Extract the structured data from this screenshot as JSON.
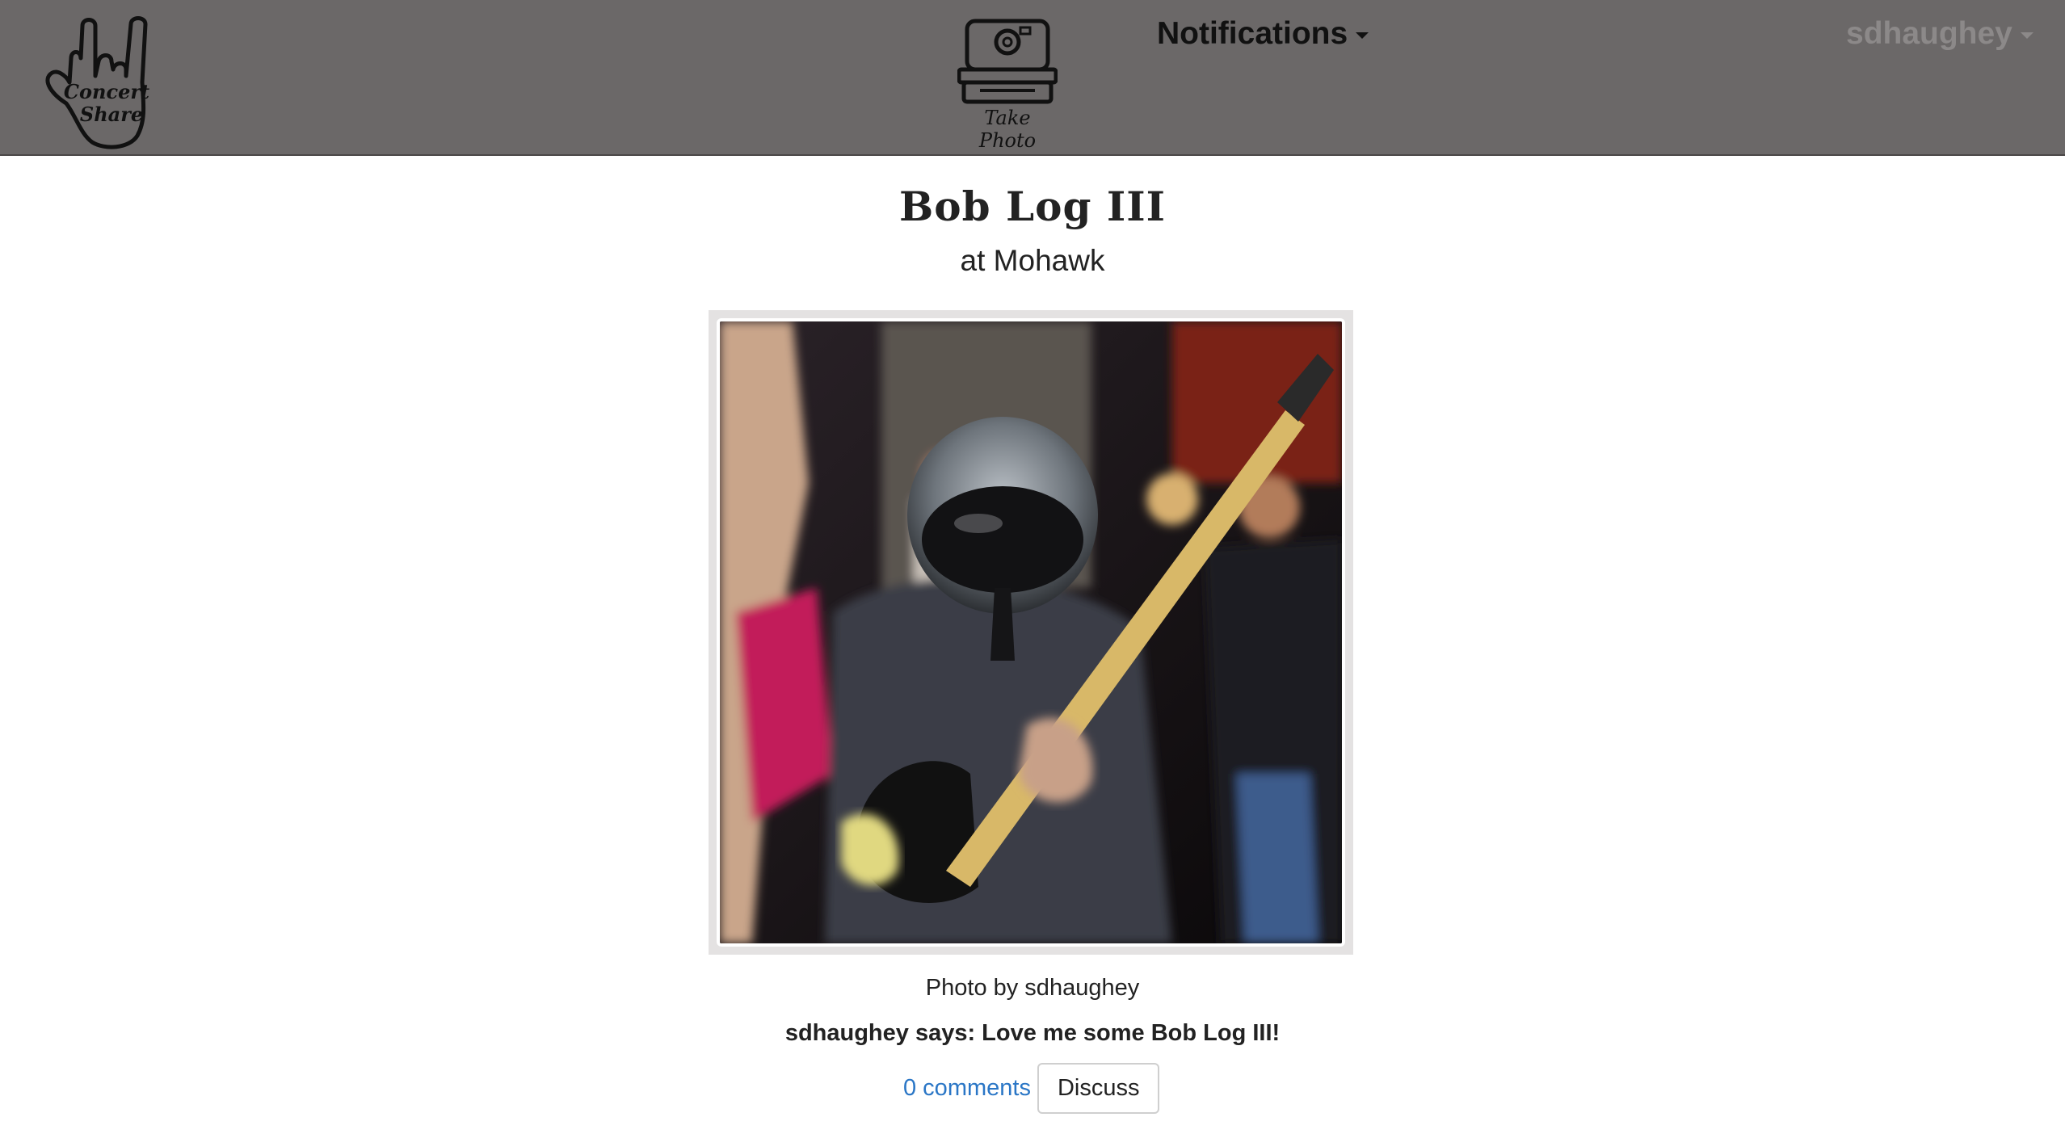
{
  "nav": {
    "logo_alt": "Concert Share",
    "take_photo_label": "Take Photo",
    "notifications_label": "Notifications",
    "username": "sdhaughey"
  },
  "post": {
    "artist": "Bob Log III",
    "venue": "at Mohawk",
    "photo_caption": "Photo by sdhaughey",
    "user_comment": "sdhaughey says: Love me some Bob Log III!",
    "comments_link": "0 comments",
    "discuss_label": "Discuss"
  },
  "colors": {
    "navbar_bg": "#6b6868",
    "link": "#2a76c6",
    "username_muted": "#8c8989"
  }
}
